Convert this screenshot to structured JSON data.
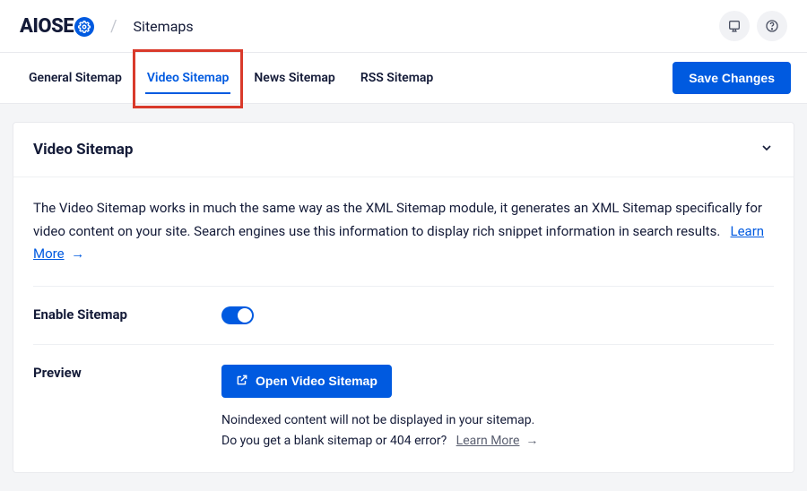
{
  "header": {
    "logo_prefix": "AIOSE",
    "breadcrumb": "Sitemaps"
  },
  "tabs": {
    "items": [
      {
        "label": "General Sitemap"
      },
      {
        "label": "Video Sitemap"
      },
      {
        "label": "News Sitemap"
      },
      {
        "label": "RSS Sitemap"
      }
    ],
    "active_index": 1,
    "save_label": "Save Changes"
  },
  "card": {
    "title": "Video Sitemap",
    "intro_text": "The Video Sitemap works in much the same way as the XML Sitemap module, it generates an XML Sitemap specifically for video content on your site. Search engines use this information to display rich snippet information in search results.",
    "intro_link_label": "Learn More",
    "enable": {
      "label": "Enable Sitemap",
      "value": true
    },
    "preview": {
      "label": "Preview",
      "button_label": "Open Video Sitemap",
      "helper_line1": "Noindexed content will not be displayed in your sitemap.",
      "helper_line2_prefix": "Do you get a blank sitemap or 404 error?",
      "helper_link_label": "Learn More"
    }
  }
}
